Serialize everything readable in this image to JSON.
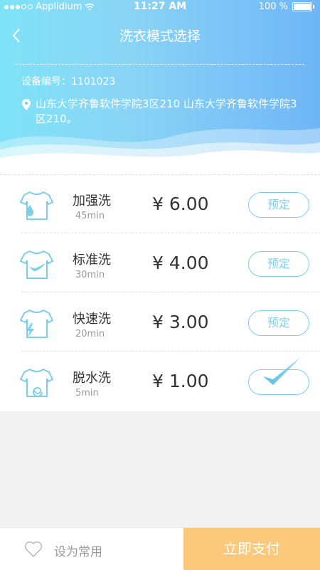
{
  "status_bar": {
    "carrier": "Applidium",
    "time": "11:27 AM",
    "battery": "100 %"
  },
  "nav": {
    "title": "洗衣模式选择"
  },
  "device": {
    "id_text": "设备编号：1101023",
    "address": "山东大学齐鲁软件学院3区210 山东大学齐鲁软件学院3区210。"
  },
  "modes": [
    {
      "name": "加强洗",
      "duration": "45min",
      "price": "¥ 6.00",
      "action": "预定",
      "icon": "shirt-water-drop-icon",
      "selected": false
    },
    {
      "name": "标准洗",
      "duration": "30min",
      "price": "¥ 4.00",
      "action": "预定",
      "icon": "shirt-check-icon",
      "selected": false
    },
    {
      "name": "快速洗",
      "duration": "20min",
      "price": "¥ 3.00",
      "action": "预定",
      "icon": "shirt-lightning-icon",
      "selected": false
    },
    {
      "name": "脱水洗",
      "duration": "5min",
      "price": "¥ 1.00",
      "action": "",
      "icon": "shirt-spin-icon",
      "selected": true
    }
  ],
  "footer": {
    "favorite_label": "设为常用",
    "pay_label": "立即支付"
  },
  "colors": {
    "accent": "#7ccfe9",
    "pay": "#fcc97a"
  }
}
